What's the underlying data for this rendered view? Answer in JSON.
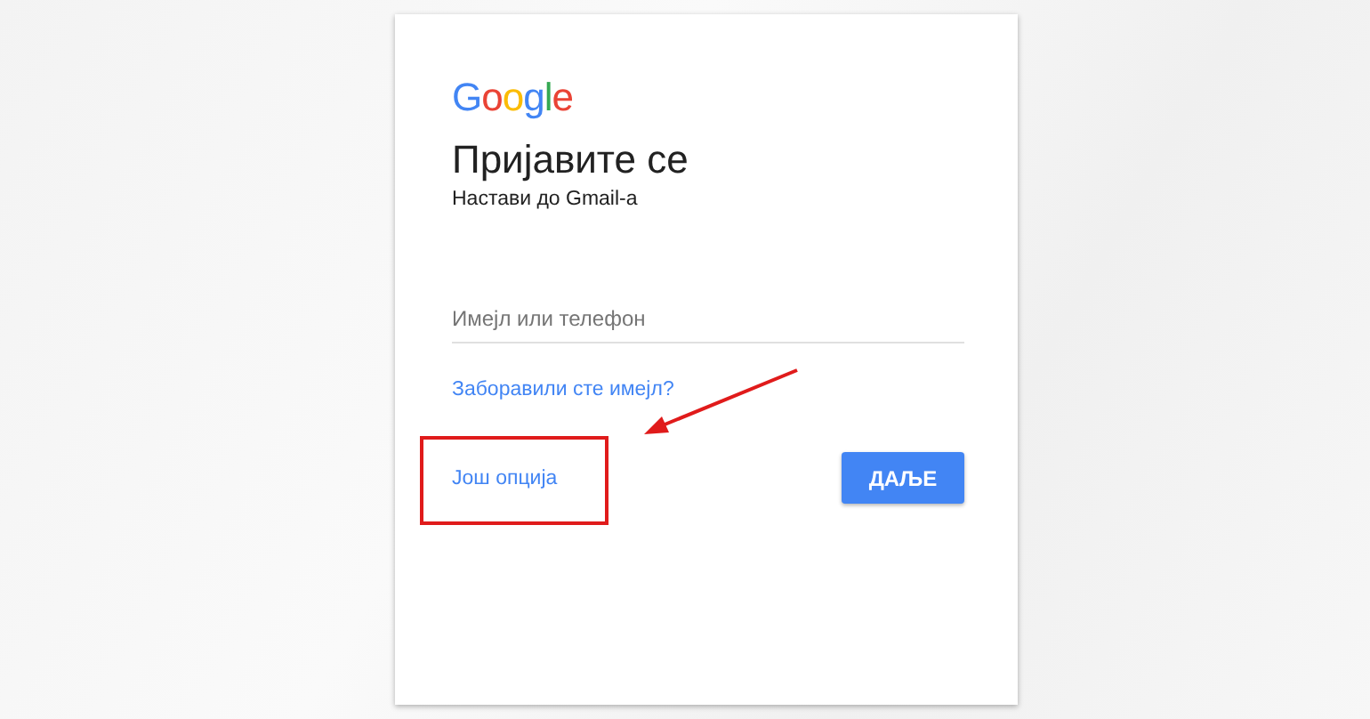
{
  "logo": "Google",
  "title": "Пријавите се",
  "subtitle": "Настави до Gmail-а",
  "email_field": {
    "placeholder": "Имејл или телефон"
  },
  "forgot_link": "Заборавили сте имејл?",
  "more_options_link": "Још опција",
  "next_button": "ДАЉЕ"
}
